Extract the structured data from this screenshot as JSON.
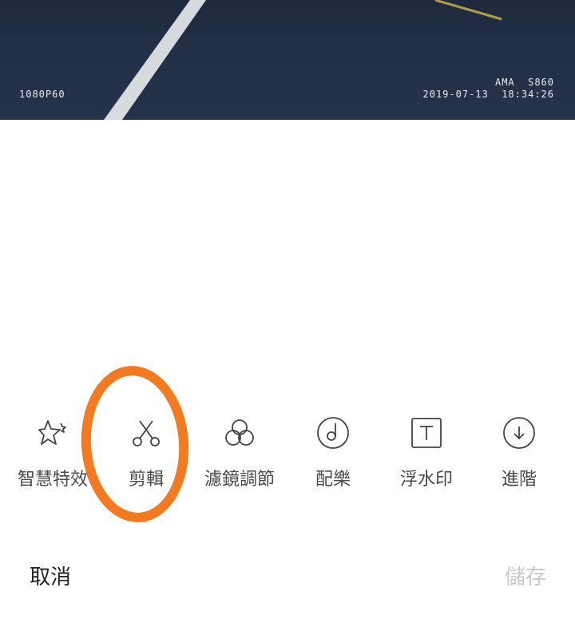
{
  "video": {
    "resolution": "1080P60",
    "device": "AMA  S860",
    "timestamp": "2019-07-13  18:34:26"
  },
  "toolbar": {
    "tools": [
      {
        "label": "智慧特效",
        "icon": "star-magic-icon"
      },
      {
        "label": "剪輯",
        "icon": "scissors-icon"
      },
      {
        "label": "濾鏡調節",
        "icon": "filter-circles-icon"
      },
      {
        "label": "配樂",
        "icon": "music-note-icon"
      },
      {
        "label": "浮水印",
        "icon": "text-box-icon"
      },
      {
        "label": "進階",
        "icon": "arrow-down-circle-icon"
      }
    ]
  },
  "footer": {
    "cancel_label": "取消",
    "save_label": "儲存"
  },
  "colors": {
    "highlight": "#f47a20",
    "text_primary": "#222222",
    "text_disabled": "#c9c9c9"
  }
}
